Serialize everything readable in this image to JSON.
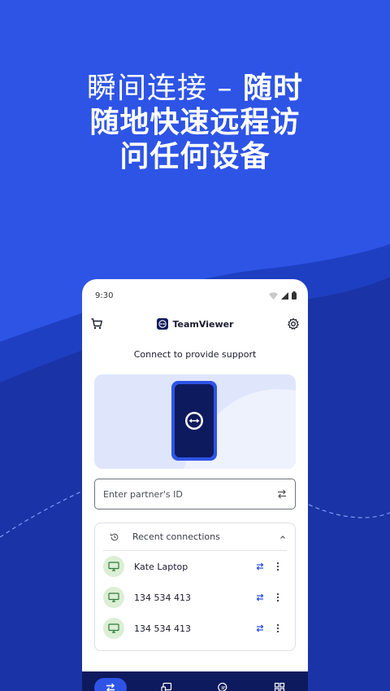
{
  "headline": {
    "line1_light": "瞬间连接 – ",
    "line1_bold": "随时",
    "line2": "随地快速远程访",
    "line3": "问任何设备"
  },
  "status_bar": {
    "time": "9:30"
  },
  "header": {
    "brand": "TeamViewer",
    "cart_icon": "cart-icon",
    "settings_icon": "gear-icon"
  },
  "main": {
    "subtitle": "Connect to provide support",
    "partner_id_placeholder": "Enter partner's ID"
  },
  "recent": {
    "title": "Recent connections",
    "items": [
      {
        "name": "Kate Laptop"
      },
      {
        "name": "134 534 413"
      },
      {
        "name": "134 534 413"
      }
    ]
  },
  "colors": {
    "background": "#2e54e6",
    "dark_wave": "#1d35a8",
    "nav": "#0e1a5e",
    "device_badge": "#dcefd5"
  }
}
